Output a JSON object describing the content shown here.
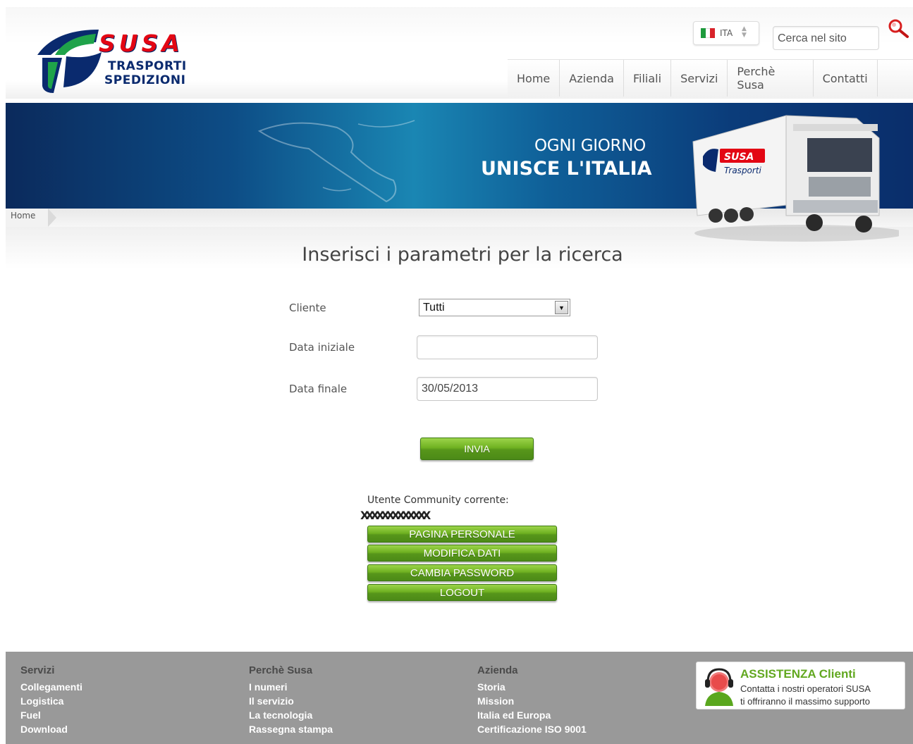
{
  "brand": {
    "name": "SUSA",
    "subtitle_1": "TRASPORTI",
    "subtitle_2": "SPEDIZIONI",
    "colors": {
      "red": "#e30613",
      "navy": "#0a2a6e",
      "green": "#62a820"
    }
  },
  "header": {
    "language": {
      "code": "ITA",
      "flag_icon": "italy-flag-icon"
    },
    "search": {
      "placeholder": "Cerca nel sito",
      "icon": "search-icon"
    },
    "nav": [
      "Home",
      "Azienda",
      "Filiali",
      "Servizi",
      "Perchè Susa",
      "Contatti"
    ]
  },
  "banner": {
    "line1": "OGNI GIORNO",
    "line2": "UNISCE L'ITALIA",
    "truck_label": "Trasporti"
  },
  "breadcrumb": [
    "Home"
  ],
  "form": {
    "title": "Inserisci i parametri per la ricerca",
    "cliente": {
      "label": "Cliente",
      "selected": "Tutti"
    },
    "data_iniziale": {
      "label": "Data iniziale",
      "value": ""
    },
    "data_finale": {
      "label": "Data finale",
      "value": "30/05/2013"
    },
    "submit": "INVIA"
  },
  "user": {
    "label": "Utente Community corrente:",
    "name": "XXXXXXXXXXXXX",
    "buttons": [
      "PAGINA PERSONALE",
      "MODIFICA DATI",
      "CAMBIA PASSWORD",
      "LOGOUT"
    ]
  },
  "footer": {
    "columns": [
      {
        "title": "Servizi",
        "links": [
          "Collegamenti",
          "Logistica",
          "Fuel",
          "Download"
        ]
      },
      {
        "title": "Perchè Susa",
        "links": [
          "I numeri",
          "Il servizio",
          "La tecnologia",
          "Rassegna stampa"
        ]
      },
      {
        "title": "Azienda",
        "links": [
          "Storia",
          "Mission",
          "Italia ed Europa",
          "Certificazione ISO 9001"
        ]
      }
    ],
    "assistance": {
      "title": "ASSISTENZA Clienti",
      "line1": "Contatta i nostri operatori SUSA",
      "line2": "ti offriranno il massimo supporto"
    }
  }
}
